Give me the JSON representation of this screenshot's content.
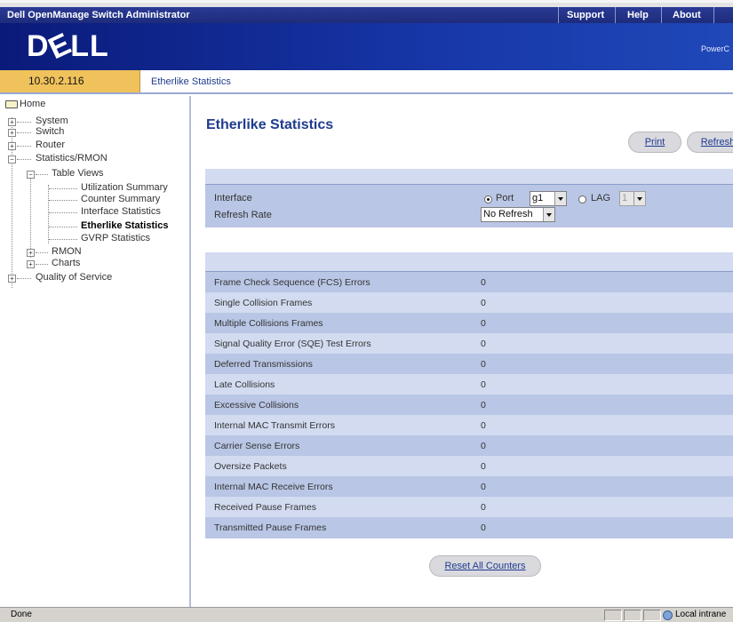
{
  "app": {
    "title": "Dell OpenManage Switch Administrator",
    "top_links": [
      "Support",
      "Help",
      "About"
    ],
    "logo_text": "D",
    "logo_e": "E",
    "logo_tail": "LL",
    "product": "PowerC"
  },
  "address": {
    "ip": "10.30.2.116",
    "breadcrumb": "Etherlike Statistics"
  },
  "sidebar": {
    "home": "Home",
    "items": {
      "system": "System",
      "switch": "Switch",
      "router": "Router",
      "stats": "Statistics/RMON",
      "table_views": "Table Views",
      "utilization": "Utilization Summary",
      "counter": "Counter Summary",
      "interface_stats": "Interface Statistics",
      "etherlike": "Etherlike Statistics",
      "gvrp": "GVRP Statistics",
      "rmon": "RMON",
      "charts": "Charts",
      "qos": "Quality of Service"
    }
  },
  "main": {
    "title": "Etherlike Statistics",
    "print": "Print",
    "refresh": "Refresh",
    "interface_label": "Interface",
    "port_label": "Port",
    "port_value": "g1",
    "lag_label": "LAG",
    "lag_value": "1",
    "refresh_rate_label": "Refresh Rate",
    "refresh_rate_value": "No Refresh",
    "reset_button": "Reset All Counters"
  },
  "stats": {
    "rows": [
      {
        "name": "Frame Check Sequence (FCS) Errors",
        "value": "0"
      },
      {
        "name": "Single Collision Frames",
        "value": "0"
      },
      {
        "name": "Multiple Collisions Frames",
        "value": "0"
      },
      {
        "name": "Signal Quality Error (SQE) Test Errors",
        "value": "0"
      },
      {
        "name": "Deferred Transmissions",
        "value": "0"
      },
      {
        "name": "Late Collisions",
        "value": "0"
      },
      {
        "name": "Excessive Collisions",
        "value": "0"
      },
      {
        "name": "Internal MAC Transmit Errors",
        "value": "0"
      },
      {
        "name": "Carrier Sense Errors",
        "value": "0"
      },
      {
        "name": "Oversize Packets",
        "value": "0"
      },
      {
        "name": "Internal MAC Receive Errors",
        "value": "0"
      },
      {
        "name": "Received Pause Frames",
        "value": "0"
      },
      {
        "name": "Transmitted Pause Frames",
        "value": "0"
      }
    ]
  },
  "status": {
    "text": "Done",
    "zone": "Local intrane"
  },
  "colors": {
    "accent": "#1f3b8f",
    "ip_cell": "#f0c25c",
    "panel": "#b9c6e5",
    "panel_alt": "#d2dbf0"
  }
}
